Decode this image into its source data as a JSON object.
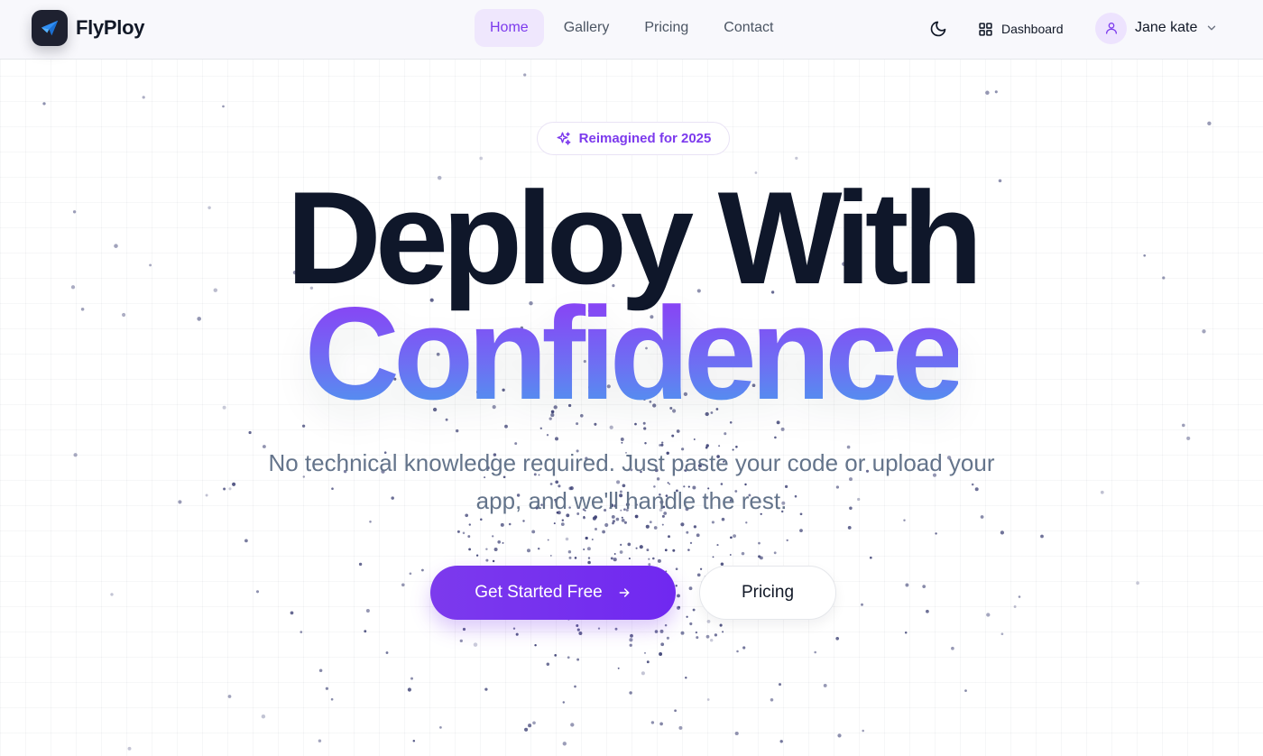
{
  "header": {
    "brand": "FlyPloy",
    "nav": [
      {
        "label": "Home",
        "active": true
      },
      {
        "label": "Gallery",
        "active": false
      },
      {
        "label": "Pricing",
        "active": false
      },
      {
        "label": "Contact",
        "active": false
      }
    ],
    "theme_toggle_icon": "moon-icon",
    "dashboard_label": "Dashboard",
    "dashboard_icon": "grid-icon",
    "user_name": "Jane kate",
    "user_icon": "user-icon",
    "user_menu_icon": "chevron-down-icon"
  },
  "hero": {
    "badge": "Reimagined for 2025",
    "badge_icon": "sparkles-icon",
    "headline_line1": "Deploy With",
    "headline_line2": "Confidence",
    "subtext": "No technical knowledge required. Just paste your code or upload your app, and we'll handle the rest.",
    "primary_cta": "Get Started Free",
    "primary_cta_icon": "arrow-right-icon",
    "secondary_cta": "Pricing"
  },
  "colors": {
    "accent": "#7c3aed",
    "accent_light": "#efe7fd",
    "heading": "#0f172a",
    "muted_text": "#64748b",
    "gradient_top": "#8b3ff5",
    "gradient_bottom": "#4f95ef",
    "particle": "#3b3f73"
  }
}
